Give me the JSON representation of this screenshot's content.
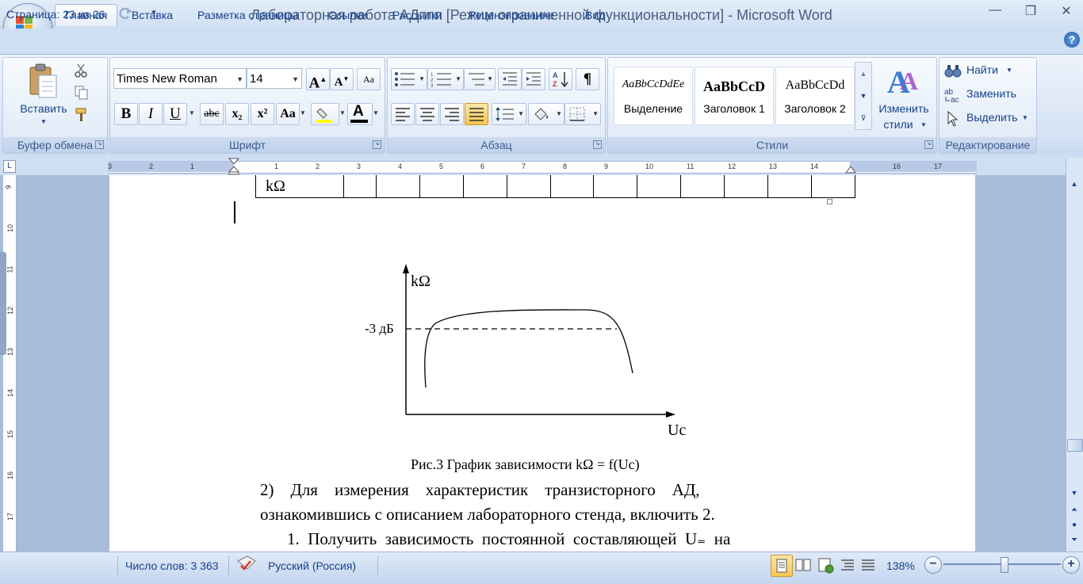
{
  "window": {
    "title": "Лабораторная работа АДппп [Режим ограниченной функциональности] - Microsoft Word",
    "minimize": "—",
    "restore": "❐",
    "close": "✕"
  },
  "tabs": [
    "Главная",
    "Вставка",
    "Разметка страницы",
    "Ссылки",
    "Рассылки",
    "Рецензирование",
    "Вид"
  ],
  "ribbon": {
    "clipboard": {
      "label": "Буфер обмена",
      "paste": "Вставить"
    },
    "font": {
      "label": "Шрифт",
      "font_name": "Times New Roman",
      "font_size": "14",
      "bold": "B",
      "italic": "I",
      "underline": "U",
      "strike": "abc",
      "subscript": "x₂",
      "superscript": "x²",
      "change_case": "Aa"
    },
    "paragraph": {
      "label": "Абзац",
      "show_marks": "¶"
    },
    "styles": {
      "label": "Стили",
      "items": [
        {
          "sample": "AaBbCcDdEe",
          "name": "Выделение"
        },
        {
          "sample": "AaBbCcD",
          "name": "Заголовок 1"
        },
        {
          "sample": "AaBbCcDd",
          "name": "Заголовок 2"
        }
      ],
      "change_styles_line1": "Изменить",
      "change_styles_line2": "стили"
    },
    "editing": {
      "label": "Редактирование",
      "find": "Найти",
      "replace": "Заменить",
      "select": "Выделить"
    }
  },
  "ruler": {
    "numbers": [
      "3",
      "2",
      "1",
      "1",
      "2",
      "3",
      "4",
      "5",
      "6",
      "7",
      "8",
      "9",
      "10",
      "11",
      "12",
      "13",
      "14",
      "16",
      "17"
    ],
    "vnumbers": [
      "9",
      "10",
      "11",
      "12",
      "13",
      "14",
      "15",
      "16",
      "17"
    ]
  },
  "document": {
    "table_cell": "kΩ",
    "chart_ylabel": "kΩ",
    "chart_xlabel": "Uc",
    "chart_level": "-3 дБ",
    "caption": "Рис.3 График зависимости  kΩ = f(Uc)",
    "para1_line1": "2)    Для    измерения    характеристик    транзисторного    АД,",
    "para1_line2": "ознакомившись с описанием лабораторного стенда, включить 2.",
    "para2_line1": "1.  Получить  зависимость  постоянной  составляющей  U₌  на"
  },
  "status": {
    "page": "Страница: 23 из 26",
    "words": "Число слов: 3 363",
    "language": "Русский (Россия)",
    "zoom": "138%"
  },
  "colors": {
    "ribbon_bg": "#dae6f5",
    "accent": "#15428b",
    "highlight": "#ffff00",
    "font_color": "#000000"
  }
}
